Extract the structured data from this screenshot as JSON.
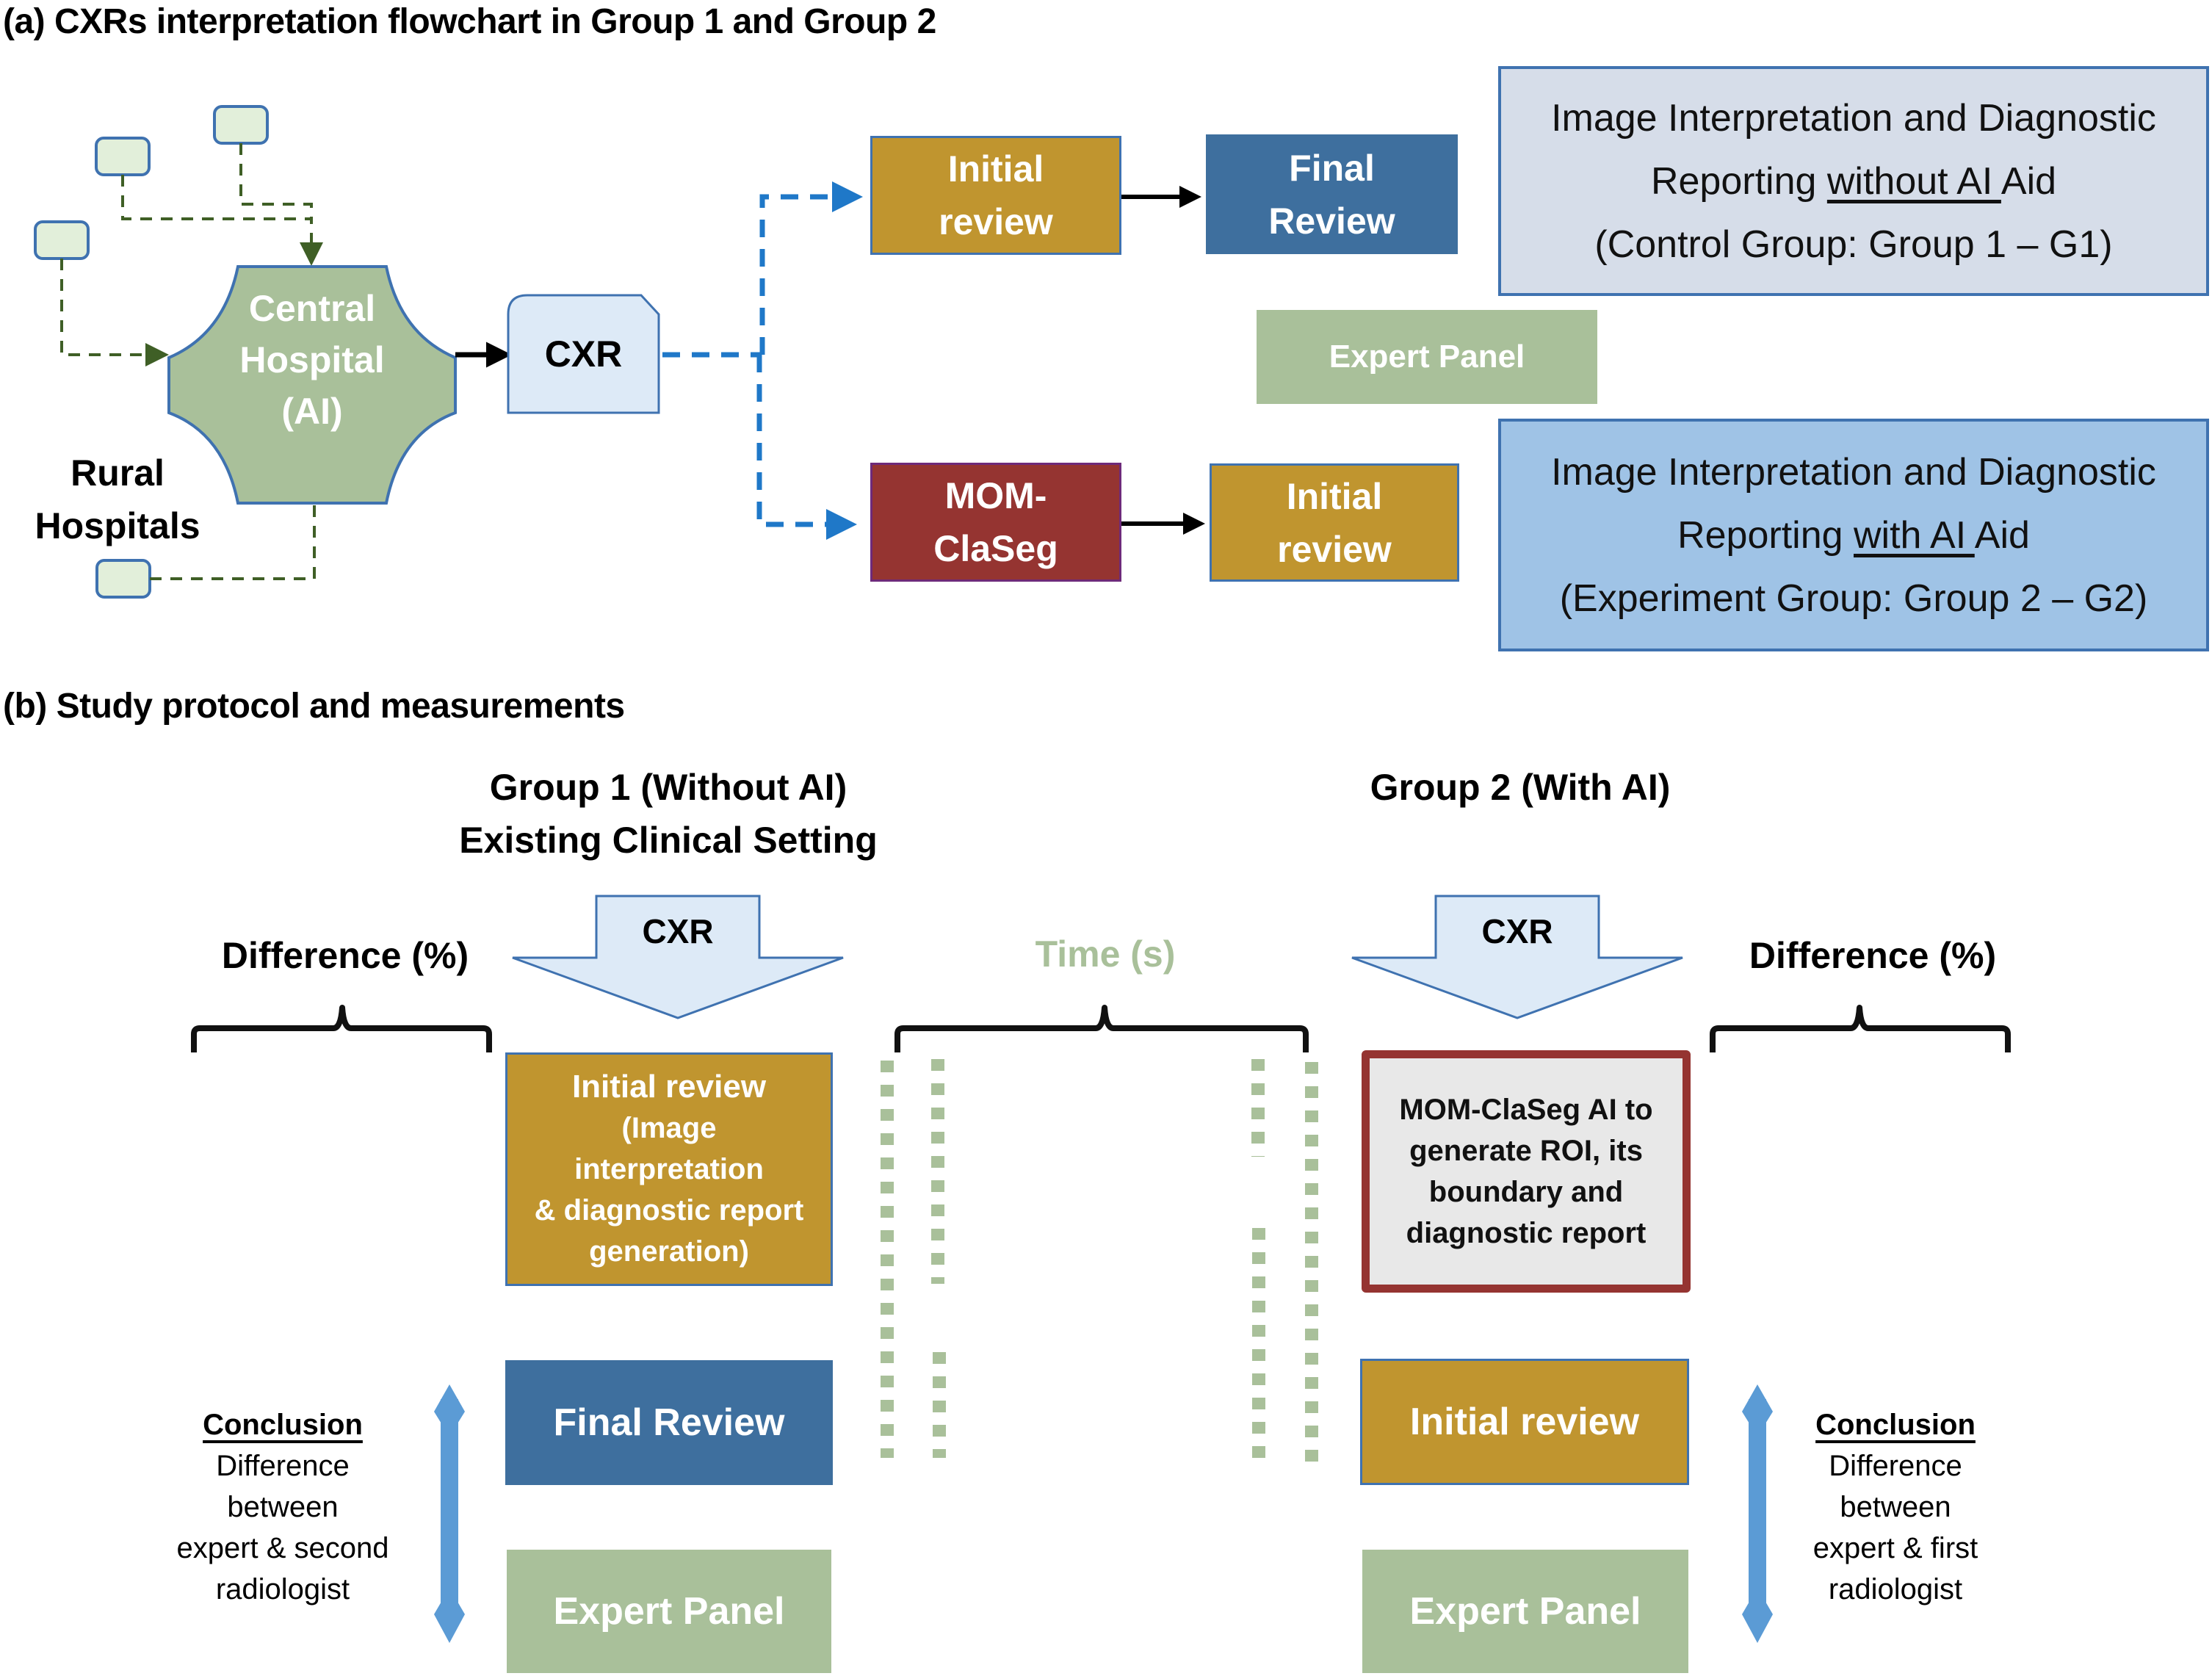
{
  "panel_a": {
    "title": "(a) CXRs interpretation flowchart in Group 1 and Group 2",
    "central_hospital": [
      "Central",
      "Hospital",
      "(AI)"
    ],
    "rural_hospitals": [
      "Rural",
      "Hospitals"
    ],
    "cxr_label": "CXR",
    "g1_flow": {
      "initial_review": [
        "Initial",
        "review"
      ],
      "final_review": [
        "Final",
        "Review"
      ]
    },
    "g2_flow": {
      "ai_model": [
        "MOM-",
        "ClaSeg"
      ],
      "initial_review": [
        "Initial",
        "review"
      ]
    },
    "expert_panel": "Expert Panel",
    "control_box": {
      "line1": "Image Interpretation and Diagnostic",
      "line2_pre": "Reporting ",
      "line2_u": "without AI ",
      "line2_post": "Aid",
      "line3": "(Control Group: Group 1 – G1)"
    },
    "experiment_box": {
      "line1": "Image Interpretation and Diagnostic",
      "line2_pre": "Reporting ",
      "line2_u": "with AI ",
      "line2_post": "Aid",
      "line3": "(Experiment Group: Group 2 – G2)"
    }
  },
  "panel_b": {
    "title": "(b) Study protocol and measurements",
    "group1_title": [
      "Group 1 (Without AI)",
      "Existing Clinical Setting"
    ],
    "group2_title": "Group 2 (With AI)",
    "difference_label": "Difference (%)",
    "time_label": "Time (s)",
    "cxr_label": "CXR",
    "g1_initial_review": [
      "Initial review",
      "(Image",
      "interpretation",
      "& diagnostic report",
      "generation)"
    ],
    "g1_final_review": "Final Review",
    "g1_expert_panel": "Expert Panel",
    "g2_ai_box": [
      "MOM-ClaSeg AI to",
      "generate ROI, its",
      "boundary and",
      "diagnostic report"
    ],
    "g2_initial_review": "Initial review",
    "g2_expert_panel": "Expert Panel",
    "conclusion_left": {
      "title": "Conclusion",
      "lines": [
        "Difference",
        "between",
        "expert & second",
        "radiologist"
      ]
    },
    "conclusion_right": {
      "title": "Conclusion",
      "lines": [
        "Difference",
        "between",
        "expert & first",
        "radiologist"
      ]
    }
  },
  "colors": {
    "gold": "#c0952f",
    "steel_blue": "#3e6f9e",
    "sage_green": "#a9c09a",
    "maroon": "#953431",
    "light_blue": "#ddeaf7",
    "control_bg": "#d6dde9",
    "experiment_bg": "#9fc3e6",
    "dash_blue": "#1f78c8",
    "dash_green": "#3f5f26",
    "conclusion_arrow": "#5b9bd5"
  }
}
